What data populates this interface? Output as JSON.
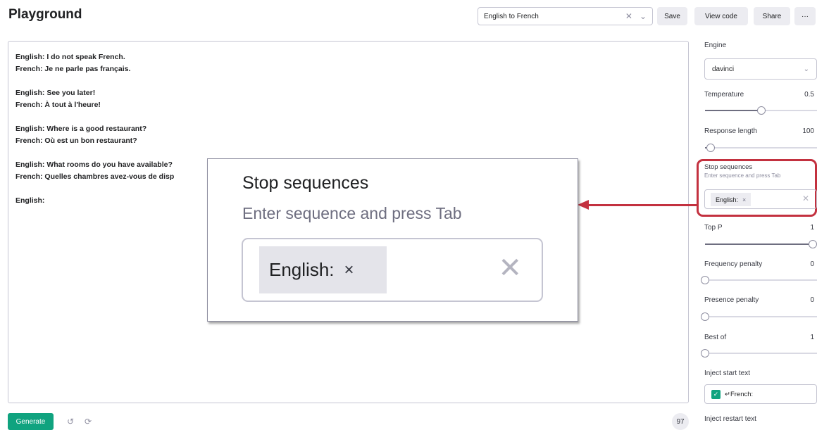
{
  "header": {
    "title": "Playground",
    "preset_value": "English to French",
    "save_label": "Save",
    "view_code_label": "View code",
    "share_label": "Share",
    "more_label": "···"
  },
  "editor": {
    "lines": [
      "English: I do not speak French.",
      "French: Je ne parle pas français.",
      "",
      "English: See you later!",
      "French: À tout à l'heure!",
      "",
      "English: Where is a good restaurant?",
      "French: Où est un bon restaurant?",
      "",
      "English: What rooms do you have available?",
      "French: Quelles chambres avez-vous de disp",
      "",
      "English:"
    ]
  },
  "footer": {
    "generate_label": "Generate",
    "token_count": "97"
  },
  "settings": {
    "engine_label": "Engine",
    "engine_value": "davinci",
    "temperature_label": "Temperature",
    "temperature_value": "0.5",
    "temperature_fraction": 0.5,
    "response_length_label": "Response length",
    "response_length_value": "100",
    "response_length_fraction": 0.05,
    "stop_sequences_label": "Stop sequences",
    "stop_sequences_hint": "Enter sequence and press Tab",
    "stop_sequence_chip": "English:",
    "top_p_label": "Top P",
    "top_p_value": "1",
    "top_p_fraction": 1.0,
    "frequency_penalty_label": "Frequency penalty",
    "frequency_penalty_value": "0",
    "frequency_penalty_fraction": 0.0,
    "presence_penalty_label": "Presence penalty",
    "presence_penalty_value": "0",
    "presence_penalty_fraction": 0.0,
    "best_of_label": "Best of",
    "best_of_value": "1",
    "best_of_fraction": 0.0,
    "inject_start_label": "Inject start text",
    "inject_start_value": "↵French:",
    "inject_restart_label": "Inject restart text"
  },
  "zoom": {
    "title": "Stop sequences",
    "hint": "Enter sequence and press Tab",
    "chip": "English:"
  },
  "icons": {
    "chip_remove": "×",
    "clear": "✕",
    "chevron": "⌄",
    "undo": "↺",
    "regenerate": "⟳",
    "check": "✓"
  },
  "colors": {
    "accent_green": "#10a37f",
    "highlight_red": "#c3313f"
  }
}
